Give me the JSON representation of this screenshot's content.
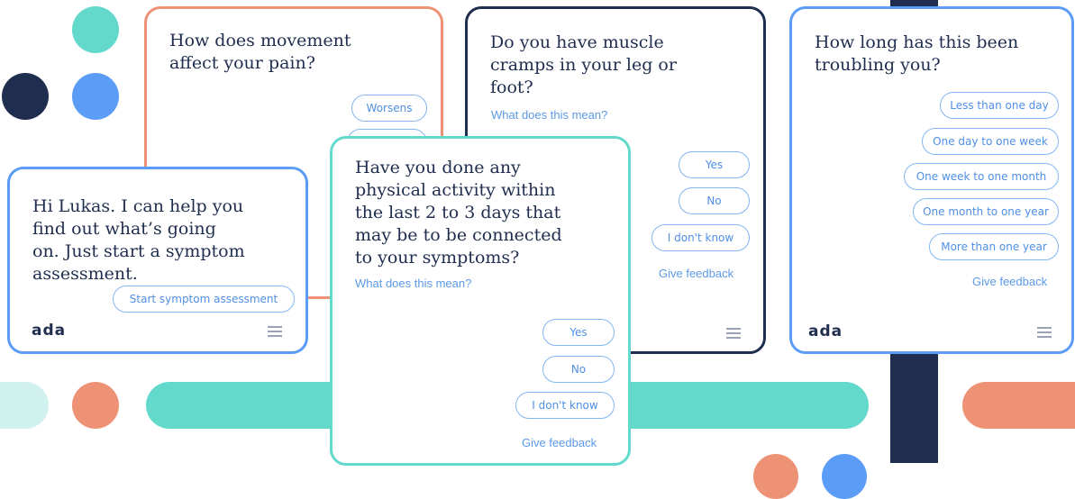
{
  "colors": {
    "teal": "#63d9cc",
    "navy": "#1f2d4e",
    "blue": "#5b9cf6",
    "coral": "#ee9276",
    "light_teal": "#d1f1ee",
    "link_blue": "#5b9ae8"
  },
  "cards": {
    "movement": {
      "question": [
        "How does movement",
        "affect your pain?"
      ],
      "options": [
        "Worsens"
      ]
    },
    "cramps": {
      "question": [
        "Do you have muscle",
        "cramps in your leg or",
        "foot?"
      ],
      "info_link": "What does this mean?",
      "options": [
        "Yes",
        "No",
        "I don't know"
      ],
      "feedback": "Give feedback",
      "menu_icon": "hamburger-menu-icon"
    },
    "duration": {
      "question": [
        "How long has this been",
        "troubling you?"
      ],
      "options": [
        "Less than one day",
        "One day to one week",
        "One week to one month",
        "One month to one year",
        "More than one year"
      ],
      "feedback": "Give feedback",
      "logo": "ada",
      "menu_icon": "hamburger-menu-icon"
    },
    "greeting": {
      "message": [
        "Hi Lukas. I can help you",
        "find out what’s going",
        "on. Just start a symptom",
        "assessment."
      ],
      "start_button": "Start symptom assessment",
      "logo": "ada",
      "menu_icon": "hamburger-menu-icon"
    },
    "activity": {
      "question": [
        "Have you done any",
        "physical activity within",
        "the last 2 to 3 days that",
        "may be to be connected",
        "to your symptoms?"
      ],
      "info_link": "What does this mean?",
      "options": [
        "Yes",
        "No",
        "I don't know"
      ],
      "feedback": "Give feedback"
    }
  }
}
